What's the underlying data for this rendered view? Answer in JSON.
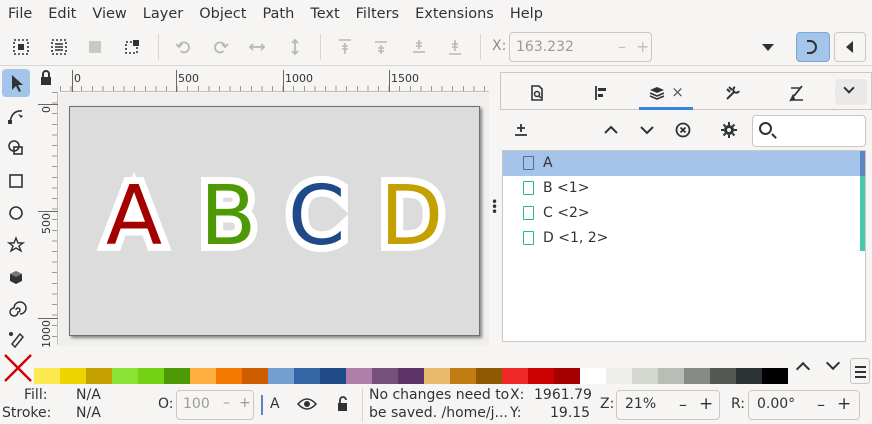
{
  "menu": [
    "File",
    "Edit",
    "View",
    "Layer",
    "Object",
    "Path",
    "Text",
    "Filters",
    "Extensions",
    "Help"
  ],
  "toolbar": {
    "x_label": "X:",
    "x_value": "163.232",
    "x_minus": "–",
    "x_plus": "+"
  },
  "ruler": {
    "top_labels": [
      "0",
      "500",
      "1000",
      "1500"
    ],
    "left_labels": [
      "0",
      "500",
      "1000"
    ]
  },
  "canvas": {
    "letters": [
      {
        "char": "A",
        "color": "#a40000"
      },
      {
        "char": "B",
        "color": "#4e9a06"
      },
      {
        "char": "C",
        "color": "#204a87"
      },
      {
        "char": "D",
        "color": "#c4a000"
      }
    ]
  },
  "dock": {
    "close_glyph": "×",
    "search_placeholder": "",
    "layers": [
      {
        "name": "A",
        "selected": true
      },
      {
        "name": "B <1>",
        "selected": false
      },
      {
        "name": "C <2>",
        "selected": false
      },
      {
        "name": "D <1, 2>",
        "selected": false
      }
    ]
  },
  "palette": {
    "colors": [
      "#fce94f",
      "#edd400",
      "#c4a000",
      "#8ae234",
      "#73d216",
      "#4e9a06",
      "#fcaf3e",
      "#f57900",
      "#ce5c00",
      "#729fcf",
      "#3465a4",
      "#204a87",
      "#ad7fa8",
      "#75507b",
      "#5c3566",
      "#e9b96e",
      "#c17d11",
      "#8f5902",
      "#ef2929",
      "#cc0000",
      "#a40000",
      "#ffffff",
      "#eeeeec",
      "#d3d7cf",
      "#babdb6",
      "#888a85",
      "#555753",
      "#2e3436",
      "#000000"
    ]
  },
  "status": {
    "fill_label": "Fill:",
    "fill_value": "N/A",
    "stroke_label": "Stroke:",
    "stroke_value": "N/A",
    "opacity_label": "O:",
    "opacity_value": "100",
    "layer_name": "A",
    "message_line1": "No changes need to",
    "message_line2": "be saved. /home/j...",
    "x_label": "X:",
    "x_value": "1961.79",
    "y_label": "Y:",
    "y_value": "19.15",
    "zoom_label": "Z:",
    "zoom_value": "21%",
    "rotate_label": "R:",
    "rotate_value": "0.00°",
    "minus": "–",
    "plus": "+"
  }
}
